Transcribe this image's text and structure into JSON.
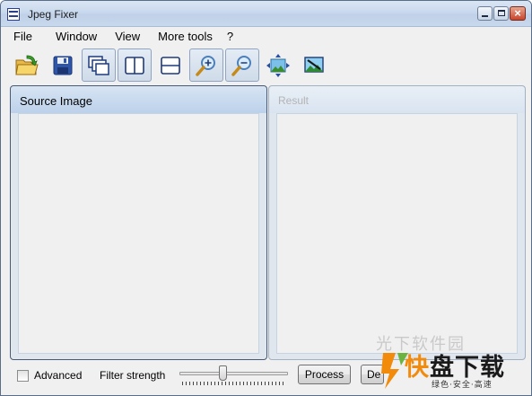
{
  "window": {
    "title": "Jpeg Fixer"
  },
  "menu": {
    "items": [
      "File",
      "Window",
      "View",
      "More tools",
      "?"
    ]
  },
  "toolbar": {
    "buttons": [
      {
        "icon": "open-folder-icon",
        "pressed": false
      },
      {
        "icon": "save-icon",
        "pressed": false
      },
      {
        "icon": "cascade-windows-icon",
        "pressed": true
      },
      {
        "icon": "tile-vertical-icon",
        "pressed": true
      },
      {
        "icon": "tile-horizontal-icon",
        "pressed": false
      },
      {
        "icon": "zoom-in-icon",
        "pressed": true
      },
      {
        "icon": "zoom-out-icon",
        "pressed": true
      },
      {
        "icon": "fit-to-window-icon",
        "pressed": false
      },
      {
        "icon": "image-edit-icon",
        "pressed": false
      }
    ]
  },
  "panels": {
    "source_title": "Source Image",
    "result_title": "Result"
  },
  "bottom": {
    "advanced_label": "Advanced",
    "advanced_checked": false,
    "filter_strength_label": "Filter strength",
    "filter_strength_fraction": 0.4,
    "process_label": "Process",
    "second_button_label": "De"
  },
  "watermark": {
    "faint": "光下软件园",
    "brand_first": "快",
    "brand_rest": "盘下载",
    "tagline": "绿色·安全·高速"
  },
  "colors": {
    "accent_orange": "#f28a0c",
    "logo_green": "#6db33f"
  }
}
